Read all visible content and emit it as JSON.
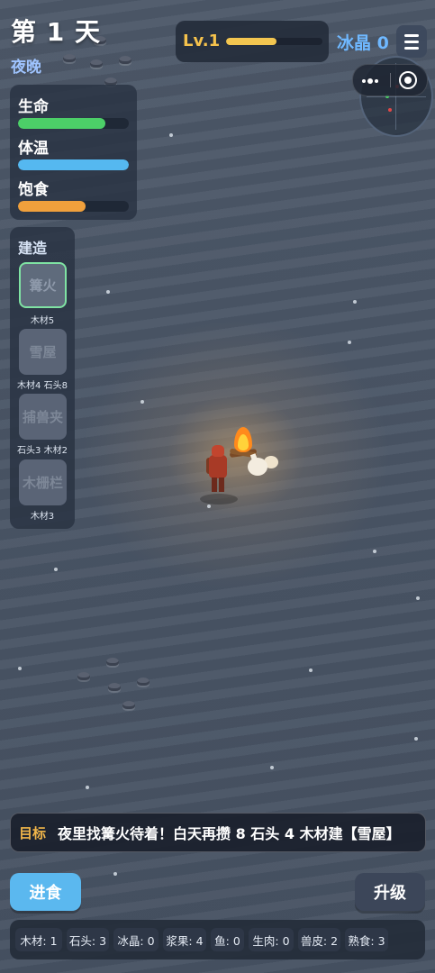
{
  "header": {
    "day_label": "第 1 天",
    "phase": "夜晚",
    "level": "Lv.1",
    "xp_fraction": 0.52,
    "crystal_label": "冰晶 0"
  },
  "stats": [
    {
      "label": "生命",
      "fraction": 0.79,
      "color": "#4ccf68"
    },
    {
      "label": "体温",
      "fraction": 1.0,
      "color": "#55b8f0"
    },
    {
      "label": "饱食",
      "fraction": 0.61,
      "color": "#f0a03c"
    }
  ],
  "build": {
    "title": "建造",
    "items": [
      {
        "name": "篝火",
        "cost": "木材5"
      },
      {
        "name": "雪屋",
        "cost": "木材4 石头8"
      },
      {
        "name": "捕兽夹",
        "cost": "石头3 木材2"
      },
      {
        "name": "木栅栏",
        "cost": "木材3"
      }
    ]
  },
  "goal": {
    "tag": "目标",
    "text": "夜里找篝火待着！白天再攒 8 石头 4 木材建【雪屋】"
  },
  "actions": {
    "eat": "进食",
    "upgrade": "升级"
  },
  "inventory": [
    "木材: 1",
    "石头: 3",
    "冰晶: 0",
    "浆果: 4",
    "鱼: 0",
    "生肉: 0",
    "兽皮: 2",
    "熟食: 3"
  ],
  "colors": {
    "accent_gold": "#f5c24c",
    "crystal_blue": "#6fb8ff",
    "eat_button": "#5bb8ef",
    "active_build_border": "#7fe3a3"
  }
}
